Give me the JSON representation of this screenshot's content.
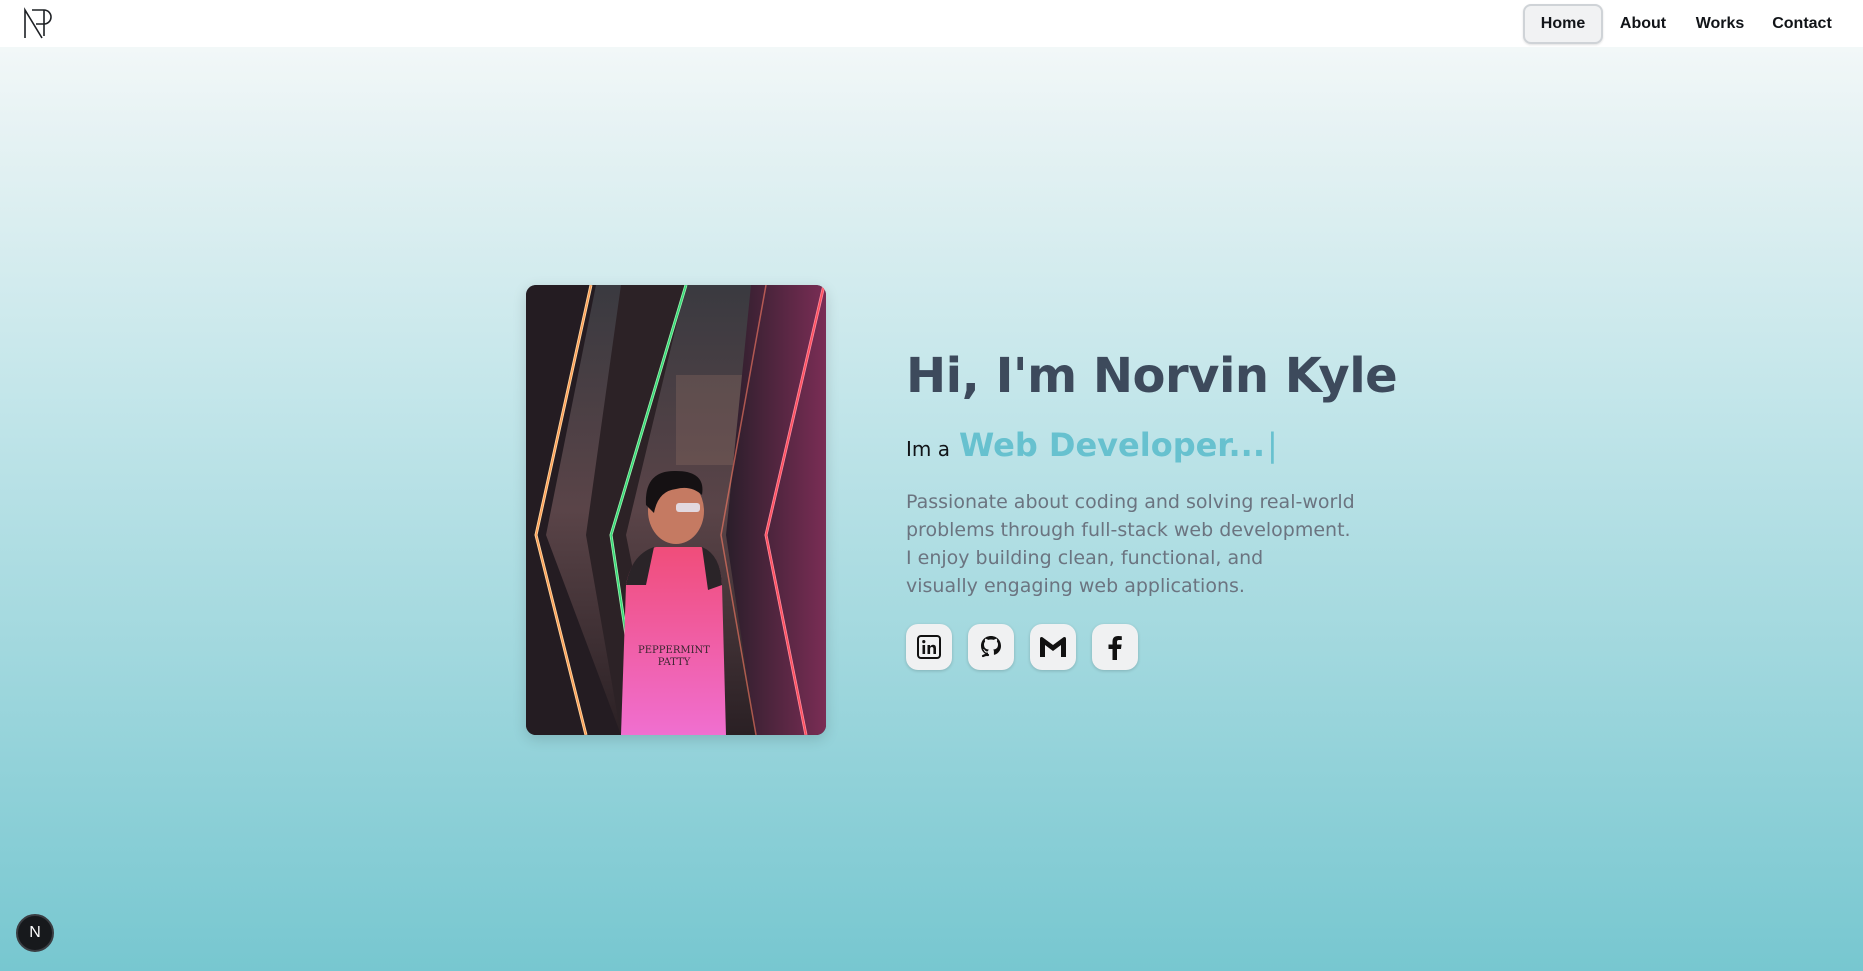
{
  "header": {
    "logo_icon": "np-monogram-icon",
    "nav": [
      {
        "label": "Home",
        "active": true
      },
      {
        "label": "About",
        "active": false
      },
      {
        "label": "Works",
        "active": false
      },
      {
        "label": "Contact",
        "active": false
      }
    ]
  },
  "hero": {
    "title": "Hi, I'm Norvin Kyle",
    "role_prefix": "Im a",
    "role_value": "Web Developer...",
    "cursor": "|",
    "bio_lines": [
      "Passionate about coding and solving real-world",
      "problems through full-stack web development.",
      "I enjoy building clean, functional, and",
      "visually engaging web applications."
    ],
    "photo_icon": "profile-photo",
    "socials": [
      {
        "icon": "linkedin-icon"
      },
      {
        "icon": "github-icon"
      },
      {
        "icon": "gmail-icon"
      },
      {
        "icon": "facebook-icon"
      }
    ]
  },
  "floating_badge": {
    "label": "N"
  },
  "colors": {
    "accent": "#67c1cf",
    "title": "#3d4a5c",
    "body_text": "#6b7480",
    "gradient_top": "#f9fbfb",
    "gradient_bottom": "#77c7d0"
  }
}
